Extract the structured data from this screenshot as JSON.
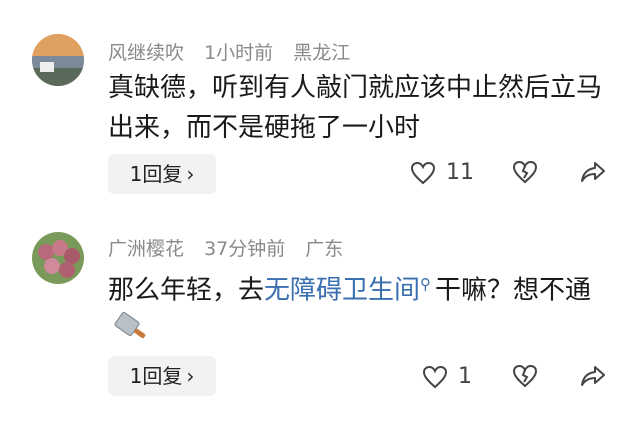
{
  "comments": [
    {
      "username": "风继续吹",
      "time": "1小时前",
      "location": "黑龙江",
      "text": "真缺德，听到有人敲门就应该中止然后立马出来，而不是硬拖了一小时",
      "reply_label": "1回复",
      "like_count": "11"
    },
    {
      "username": "广洲樱花",
      "time": "37分钟前",
      "location": "广东",
      "text_before": "那么年轻，去",
      "text_link": "无障碍卫生间",
      "text_after": "干嘛？想不通",
      "reply_label": "1回复",
      "like_count": "1"
    }
  ],
  "colors": {
    "link": "#3a6fb0",
    "meta": "#8a8a8a",
    "reply_bg": "#f2f2f2"
  },
  "icons": [
    "heart-icon",
    "broken-heart-icon",
    "share-icon",
    "search-icon",
    "knife-emoji-icon",
    "chevron-right-icon"
  ]
}
